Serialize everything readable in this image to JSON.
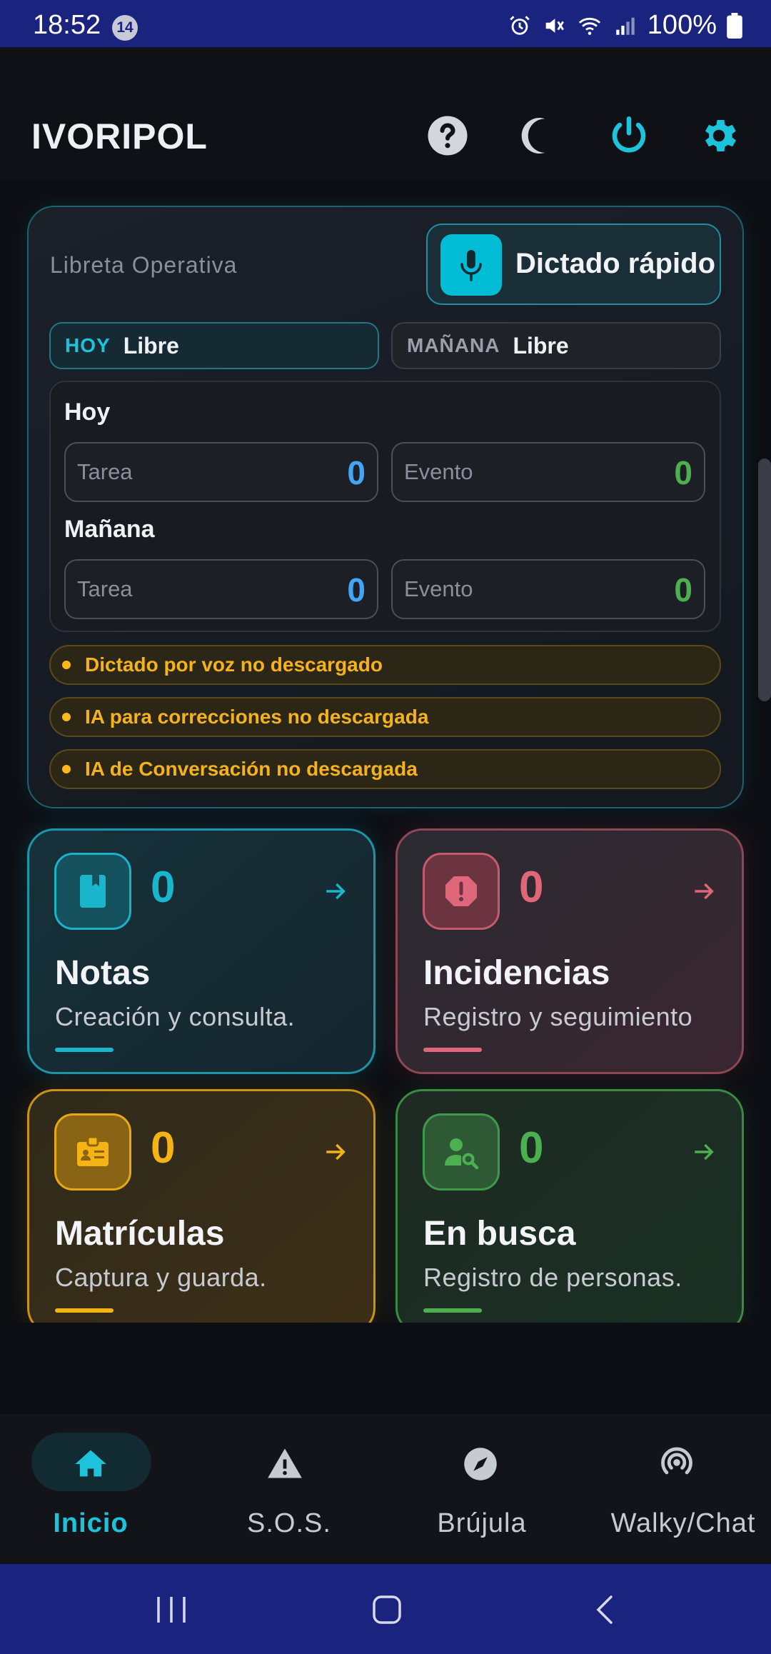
{
  "status_bar": {
    "time": "18:52",
    "notification_count": "14",
    "battery": "100%"
  },
  "header": {
    "title": "IVORIPOL",
    "icons": [
      "help-icon",
      "moon-icon",
      "power-icon",
      "settings-icon"
    ]
  },
  "notebook": {
    "label": "Libreta Operativa",
    "dictation_button": "Dictado rápido",
    "today_pill": {
      "key": "HOY",
      "value": "Libre"
    },
    "tomorrow_pill": {
      "key": "MAÑANA",
      "value": "Libre"
    },
    "today_section": "Hoy",
    "tomorrow_section": "Mañana",
    "today_task": {
      "label": "Tarea",
      "value": "0"
    },
    "today_event": {
      "label": "Evento",
      "value": "0"
    },
    "tomorrow_task": {
      "label": "Tarea",
      "value": "0"
    },
    "tomorrow_event": {
      "label": "Evento",
      "value": "0"
    },
    "warnings": [
      "Dictado por voz no descargado",
      "IA para correcciones no descargada",
      "IA de Conversación no descargada"
    ]
  },
  "tiles": [
    {
      "name": "Notas",
      "count": "0",
      "description": "Creación y consulta.",
      "icon": "book-icon",
      "color": "#19b6cc"
    },
    {
      "name": "Incidencias",
      "count": "0",
      "description": "Registro y seguimiento",
      "icon": "alert-octagon-icon",
      "color": "#e0677a"
    },
    {
      "name": "Matrículas",
      "count": "0",
      "description": "Captura y guarda.",
      "icon": "badge-icon",
      "color": "#f5b314"
    },
    {
      "name": "En busca",
      "count": "0",
      "description": "Registro de personas.",
      "icon": "person-search-icon",
      "color": "#4caf50"
    }
  ],
  "bottom_nav": [
    {
      "label": "Inicio",
      "icon": "home-icon",
      "active": true
    },
    {
      "label": "S.O.S.",
      "icon": "warning-icon",
      "active": false
    },
    {
      "label": "Brújula",
      "icon": "compass-icon",
      "active": false
    },
    {
      "label": "Walky/Chat",
      "icon": "podcast-icon",
      "active": false
    }
  ],
  "colors": {
    "accent": "#00bcd4",
    "task_number": "#42a5f5",
    "event_number": "#4caf50",
    "warning": "#f5b21a",
    "system_bar": "#1a237e"
  }
}
